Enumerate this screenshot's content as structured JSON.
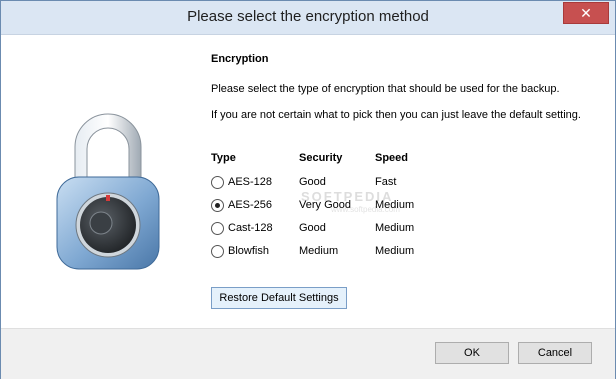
{
  "window": {
    "title": "Please select the encryption method",
    "close_label": "✕"
  },
  "section": {
    "title": "Encryption",
    "desc1": "Please select the type of encryption that should be used for the backup.",
    "desc2": "If you are not certain what to pick then you can just leave the default setting."
  },
  "table": {
    "headers": {
      "type": "Type",
      "security": "Security",
      "speed": "Speed"
    },
    "rows": [
      {
        "type": "AES-128",
        "security": "Good",
        "speed": "Fast",
        "selected": false
      },
      {
        "type": "AES-256",
        "security": "Very Good",
        "speed": "Medium",
        "selected": true
      },
      {
        "type": "Cast-128",
        "security": "Good",
        "speed": "Medium",
        "selected": false
      },
      {
        "type": "Blowfish",
        "security": "Medium",
        "speed": "Medium",
        "selected": false
      }
    ]
  },
  "buttons": {
    "restore": "Restore Default Settings",
    "ok": "OK",
    "cancel": "Cancel"
  },
  "watermark": {
    "text": "SOFTPEDIA",
    "url": "www.softpedia.com"
  },
  "colors": {
    "titlebar": "#dbe6f3",
    "footer": "#f0f0f0",
    "lock_body": "#8fb4d9",
    "dial": "#2b2f33"
  }
}
